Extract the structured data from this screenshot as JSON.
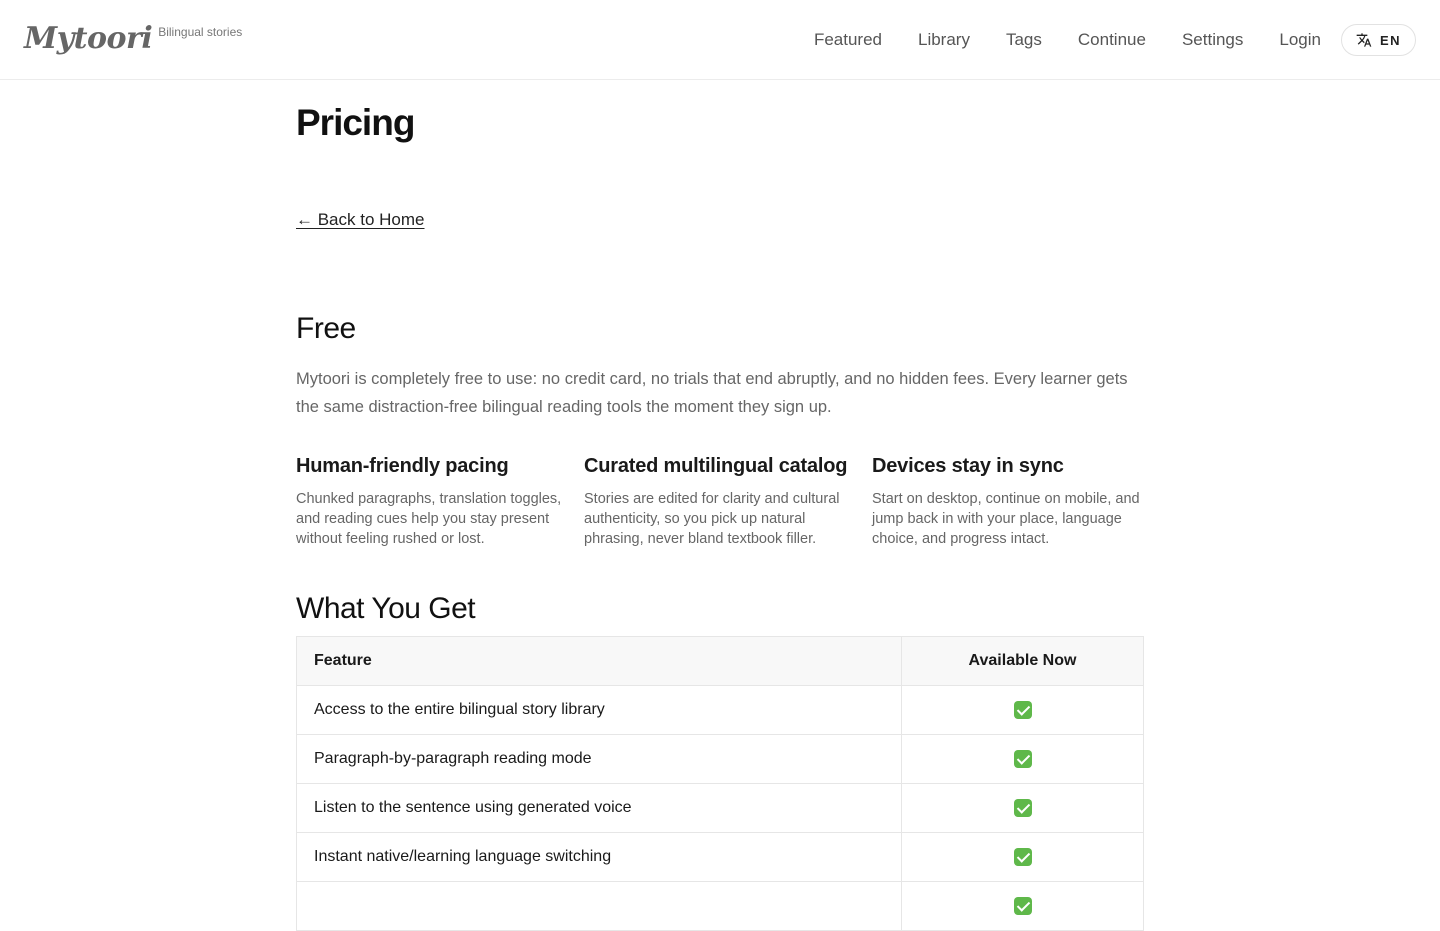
{
  "header": {
    "logo": "Mytoori",
    "tagline": "Bilingual stories",
    "nav": [
      {
        "label": "Featured"
      },
      {
        "label": "Library"
      },
      {
        "label": "Tags"
      },
      {
        "label": "Continue"
      },
      {
        "label": "Settings"
      },
      {
        "label": "Login"
      }
    ],
    "language_button": {
      "icon": "translate-icon",
      "label": "EN"
    }
  },
  "page": {
    "title": "Pricing",
    "back_link": "← Back to Home"
  },
  "free_section": {
    "heading": "Free",
    "lead": "Mytoori is completely free to use: no credit card, no trials that end abruptly, and no hidden fees. Every learner gets the same distraction-free bilingual reading tools the moment they sign up.",
    "features": [
      {
        "title": "Human-friendly pacing",
        "text": "Chunked paragraphs, translation toggles, and reading cues help you stay present without feeling rushed or lost."
      },
      {
        "title": "Curated multilingual catalog",
        "text": "Stories are edited for clarity and cultural authenticity, so you pick up natural phrasing, never bland textbook filler."
      },
      {
        "title": "Devices stay in sync",
        "text": "Start on desktop, continue on mobile, and jump back in with your place, language choice, and progress intact."
      }
    ]
  },
  "what_you_get": {
    "heading": "What You Get",
    "columns": [
      "Feature",
      "Available Now"
    ],
    "rows": [
      {
        "feature": "Access to the entire bilingual story library",
        "available": "check-icon"
      },
      {
        "feature": "Paragraph-by-paragraph reading mode",
        "available": "check-icon"
      },
      {
        "feature": "Listen to the sentence using generated voice",
        "available": "check-icon"
      },
      {
        "feature": "Instant native/learning language switching",
        "available": "check-icon"
      },
      {
        "feature": "",
        "available": "check-icon"
      }
    ]
  },
  "colors": {
    "check": "#5fb84a",
    "border": "#e6e6e6",
    "muted_text": "#666666"
  }
}
